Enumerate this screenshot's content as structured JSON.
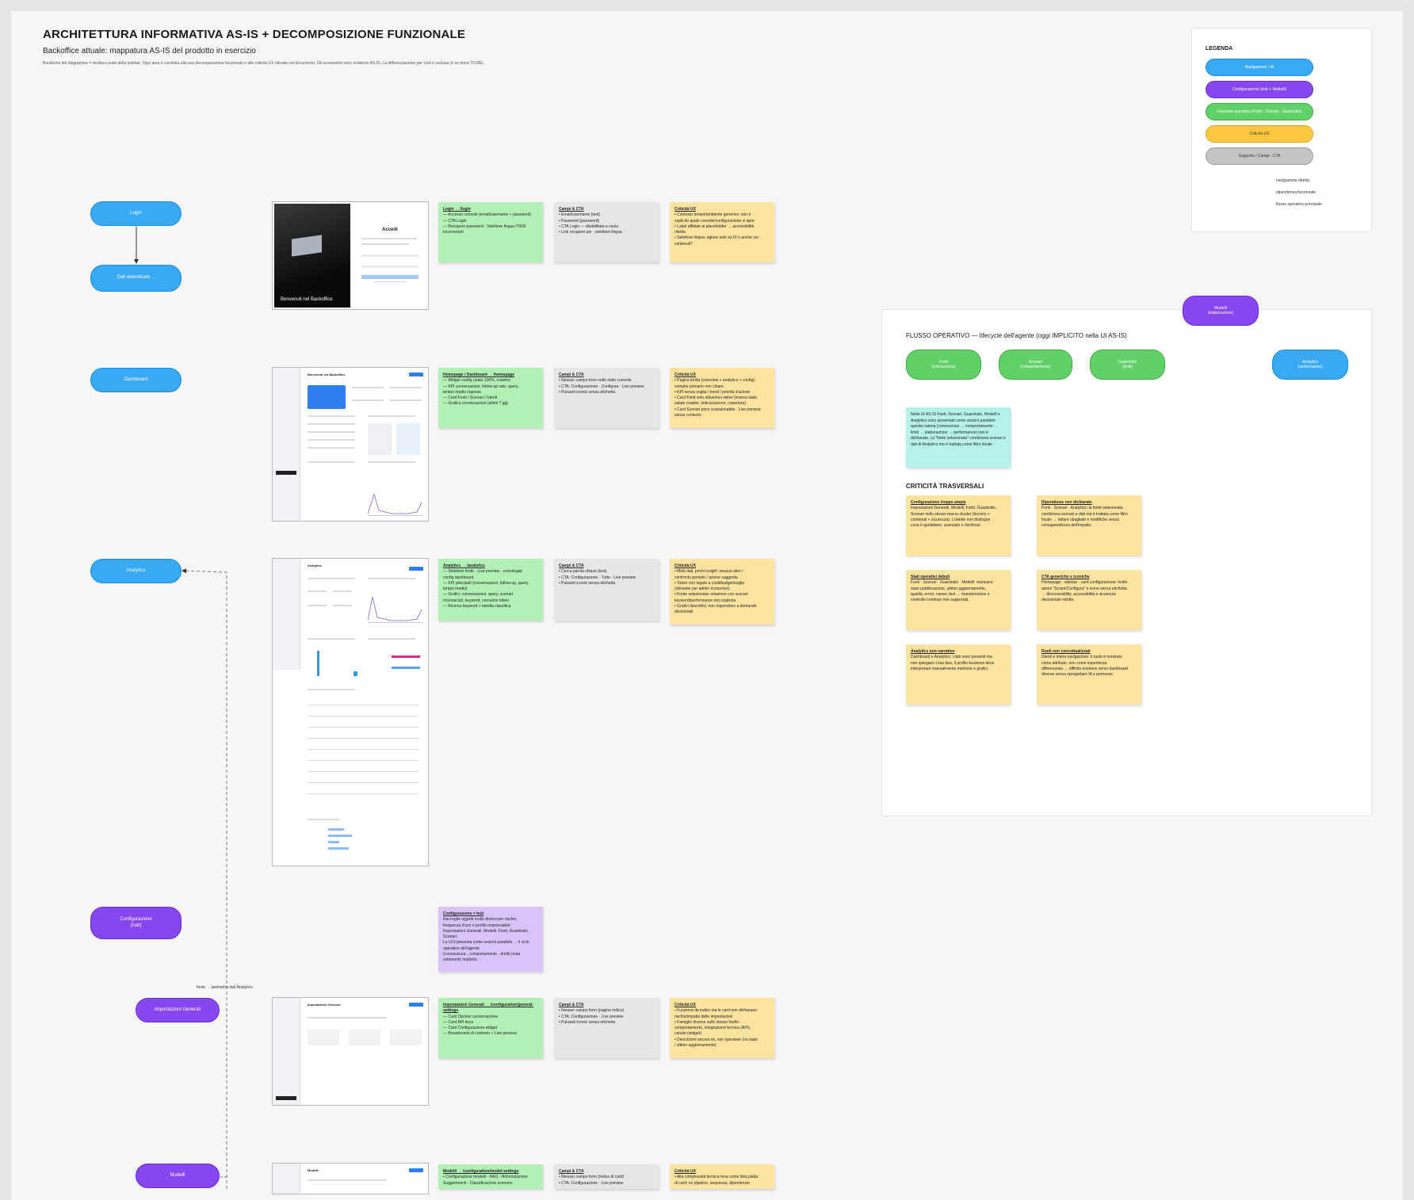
{
  "header": {
    "title": "ARCHITETTURA INFORMATIVA AS-IS  +  DECOMPOSIZIONE FUNZIONALE",
    "subtitle": "Backoffice attuale: mappatura AS-IS del prodotto in esercizio",
    "description": "Backbone del diagramma = struttura reale della sidebar. Ogni area è correlata alla sua decomposizione funzionale e alle criticità UX rilevate nel documento. Gli screenshot sono evidenze AS-IS. La differenziazione per ruoli è esclusa (è un tema TO-BE)."
  },
  "nodes": {
    "login": "Login",
    "dati": "Dati autenticato…",
    "dashboard": "Dashboard",
    "analytics": "Analytics",
    "configurazione": "Configurazione\n(hub)",
    "impostazioni": "Impostazioni Generali",
    "modelli": "Modelli"
  },
  "screens": {
    "login_welcome": "Benvenuti nel Backoffice",
    "login_access": "Accedi",
    "dashboard_title": "Benvenuti nel Backoffice",
    "analytics_title": "Analytics",
    "impostazioni_title": "Impostazioni Generali",
    "modelli_title": "Modelli"
  },
  "cards": {
    "login_green": {
      "title": "Login → /login",
      "lines": [
        "— Accesso console (email/username + password)",
        "— CTA Login",
        "— Recupero password · Selettore lingua IT/EN",
        "incorrezioni"
      ]
    },
    "login_gray": {
      "title": "Campi & CTA",
      "lines": [
        "• Email/username (text)",
        "• Password (password)",
        "• CTA Login — disabilitata a vuoto",
        "• Link recupero pw · selettore lingua"
      ]
    },
    "login_yellow": {
      "title": "Criticità UX",
      "lines": [
        "• Contesto tenant/ambiente generico: non è",
        "esplicito quale console/configurazione si apre",
        "• Label affidate ai placeholder → accessibilità",
        "ridotta",
        "• Selettore lingua: agisce solo su UI o anche sui",
        "contenuti?"
      ]
    },
    "dashboard_green": {
      "title": "Homepage / Dashboard → /homepage",
      "lines": [
        "— Widget config (stato 100%, crawler)",
        "— KPI conversazioni, follow-up rate, query,",
        "tempo medio risposta",
        "— Card Fonti / Scenari / Utenti",
        "— Grafico conversazioni (ultimi 7 gg)"
      ]
    },
    "dashboard_gray": {
      "title": "Campi & CTA",
      "lines": [
        "• Nessun campo form nello stato corrente",
        "• CTA: Configurazione · Configura · Live preview",
        "• Pulsanti iconici senza etichetta"
      ]
    },
    "dashboard_yellow": {
      "title": "Criticità UX",
      "lines": [
        "• Pagina ibrida (overview + analytics + config):",
        "compito primario non chiaro",
        "• KPI senza soglia / trend / priorità d'azione",
        "• Card Fonti solo attive/non-attive (manca stato",
        "salute crawler, indicizzazione, copertura)",
        "• Card Scenari poco scansionabile · Live preview",
        "senza contesto"
      ]
    },
    "analytics_green": {
      "title": "Analytics → /analytics",
      "lines": [
        "— Selettore fonte · Live preview · cronologia/",
        "config dashboard",
        "— KPI principali (conversazioni, follow-up, query,",
        "tempo medio)",
        "— Grafici: conversazioni, query, scenari",
        "riconosciuti, keyword, consumo token",
        "— Ricerca keyword + tabella classifica"
      ]
    },
    "analytics_gray": {
      "title": "Campi & CTA",
      "lines": [
        "• Cerca parola chiave (text)",
        "• CTA: Configurazione · Tutte · Live preview",
        "• Pulsanti iconici senza etichetta"
      ]
    },
    "analytics_yellow": {
      "title": "Criticità UX",
      "lines": [
        "• Molti dati, pochi insight: nessun alert /",
        "confronto periodo / azione suggerita",
        "• Token non legato a costi/budget/soglie",
        "(rilevante per admin economici)",
        "• Fonte selezionata: relazione con scenari",
        "keyword/performance non esplicita",
        "• Grafici descrittivi, non rispondono a domande",
        "decisionali"
      ]
    },
    "config_violet": {
      "title": "Configurazione = hub",
      "lines": [
        "Raccoglie oggetti molto diversi per rischio,",
        "frequenza d'uso e profilo responsabile:",
        "Impostazioni Generali, Modelli, Fonti, Guardrails,",
        "Scenari.",
        "La UI li presenta come sezioni parallele → il ciclo",
        "operativo dell'agente",
        "(conoscenza→comportamento→limiti) resta",
        "solamente implicito."
      ]
    },
    "imp_green": {
      "title": "Impostazioni Generali → /configuration/general-settings",
      "lines": [
        "— Card Opzioni conversazione",
        "— Card API keys",
        "— Card Configurazione widget",
        "— Breadcrumb di contesto + Live preview"
      ]
    },
    "imp_gray": {
      "title": "Campi & CTA",
      "lines": [
        "• Nessun campo form (pagina indice)",
        "• CTA: Configurazione · Live preview",
        "• Pulsanti iconici senza etichetta"
      ]
    },
    "imp_yellow": {
      "title": "Criticità UX",
      "lines": [
        "• Funziona da indice ma le card non dichiarano",
        "rischio/impatto delle impostazioni",
        "• Famiglie diverse sullo stesso livello:",
        "comportamento, integrazione tecnica (API),",
        "canale (widget)",
        "• Descrizioni ancora ok, non operative (no stato",
        "/ ultimo aggiornamento)"
      ]
    },
    "mod_green": {
      "title": "Modelli → /configuration/model-settings",
      "lines": [
        "• Configurazione modelli · RAG · Riformulazione",
        "Suggerimenti · Classificazione scenario"
      ]
    },
    "mod_gray": {
      "title": "Campi & CTA",
      "lines": [
        "• Nessun campo form (indice di card)",
        "• CTA: Configurazione · Live preview"
      ]
    },
    "mod_yellow": {
      "title": "Criticità UX",
      "lines": [
        "• Alta complessità tecnica resa come lista piatta",
        "di card: no pipeline, sequenza, dipendenze"
      ]
    }
  },
  "legend": {
    "title": "LEGENDA",
    "items": [
      "Navigazione / IA",
      "Configurazione (hub + Modelli)",
      "Funzione operativa (Fonti · Scenari · Guardrails)",
      "Criticità UX",
      "Supporto / Campi · CTA"
    ],
    "lines": [
      "navigazione diretta",
      "dipendenza funzionale",
      "flusso operativo principale"
    ]
  },
  "flow": {
    "title": "FLUSSO OPERATIVO — lifecycle dell'agente (oggi IMPLICITO nella UI AS-IS)",
    "nodes": [
      "Fonti\n(conoscenza)",
      "Scenari\n(comportamento)",
      "Guardrails\n(limiti)",
      "Modelli\n(elaborazione)",
      "Analytics\n(performance)"
    ],
    "note": "Nella UI AS-IS Fonti, Scenari, Guardrails, Modelli e Analytics sono presentati come sezioni parallele: questa catena (conoscenza → comportamento → limiti → elaborazione → performance) non è dichiarata. La \"fonte selezionata\" condiziona scenari e dati di Analytics ma è trattata come filtro locale."
  },
  "criticita": {
    "title": "CRITICITÀ TRASVERSALI",
    "cards": [
      {
        "title": "Configurazione troppo ampia",
        "lines": [
          "Impostazioni Generali, Modelli, Fonti, Guardrails,",
          "Scenari nello stesso macro-cluster (tecnico +",
          "contenuti + sicurezza). L'utente non distingue",
          "cosa è quotidiano, avanzato o rischioso."
        ]
      },
      {
        "title": "Dipendenze non dichiarate",
        "lines": [
          "Fonti · Scenari · Analytics: la fonte selezionata",
          "condiziona scenari e dati ma è trattata come filtro",
          "locale → letture sbagliate e modifiche senza",
          "consapevolezza dell'impatto."
        ]
      },
      {
        "title": "Stati operativi deboli",
        "lines": [
          "Fonti · Scenari · Guardrails · Modelli: mancano",
          "stato pubblicazione, ultimo aggiornamento,",
          "qualità, errori, owner, test → manutenzione e",
          "controllo continuo non supportati."
        ]
      },
      {
        "title": "CTA generiche e iconiche",
        "lines": [
          "Homepage · sidebar · card configurazione: molte",
          "azioni \"Scopri/Configura\" o icone senza etichetta",
          "→ discoverability, accessibilità e sicurezza",
          "decisionale ridotte."
        ]
      },
      {
        "title": "Analytics non narrativo",
        "lines": [
          "Dashboard e Analytics: i dati sono presenti ma",
          "non spiegano cosa fare, il profilo business deve",
          "interpretare manualmente metriche e grafici."
        ]
      },
      {
        "title": "Ruoli non concettualizzati",
        "lines": [
          "Utenti e intera navigazione: il ruolo è mostrato",
          "come attributo, non come esperienza",
          "differenziata → difficile evolvere verso dashboard",
          "diverse senza riprogettare IA e permessi."
        ]
      }
    ]
  },
  "annotations": {
    "fonte_label": "fonte → perimetro dati Analytics"
  },
  "colors": {
    "blue": "#3aa9f5",
    "purple": "#8846f0",
    "green": "#62d068",
    "yellow": "#fdc840",
    "gray": "#c4c4c4"
  }
}
